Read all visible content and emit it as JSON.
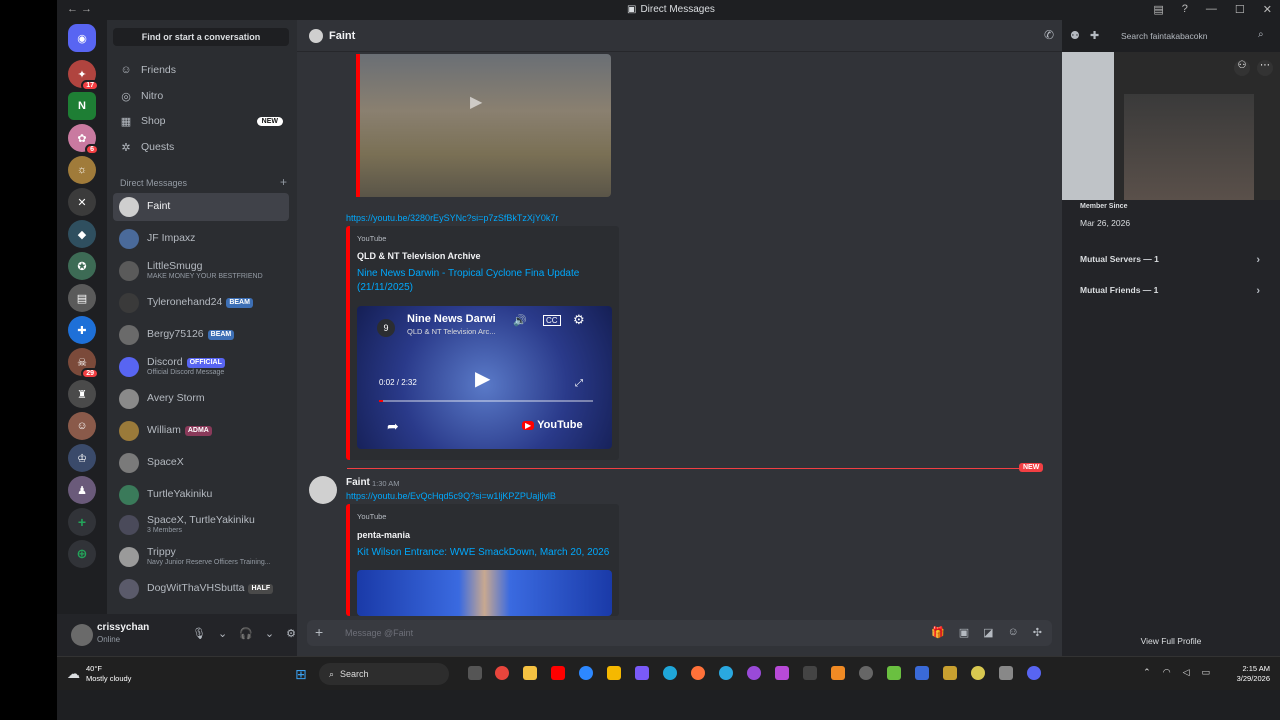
{
  "titlebar": {
    "title": "Direct Messages"
  },
  "rail": {
    "badges": [
      "17",
      "6",
      "29"
    ]
  },
  "sidebar": {
    "find_label": "Find or start a conversation",
    "nav": [
      {
        "label": "Friends",
        "icon": "friends-icon"
      },
      {
        "label": "Nitro",
        "icon": "nitro-icon"
      },
      {
        "label": "Shop",
        "icon": "shop-icon",
        "badge": "NEW"
      },
      {
        "label": "Quests",
        "icon": "quests-icon"
      }
    ],
    "dm_header": "Direct Messages",
    "dms": [
      {
        "name": "Faint",
        "sub": "",
        "tag": ""
      },
      {
        "name": "JF Impaxz",
        "sub": "",
        "tag": ""
      },
      {
        "name": "LittleSmugg",
        "sub": "MAKE MONEY YOUR BESTFRIEND",
        "tag": ""
      },
      {
        "name": "Tyleronehand24",
        "sub": "",
        "tag": "BEAM"
      },
      {
        "name": "Bergy75126",
        "sub": "",
        "tag": "BEAM"
      },
      {
        "name": "Discord",
        "sub": "Official Discord Message",
        "tag": "OFFICIAL"
      },
      {
        "name": "Avery Storm",
        "sub": "",
        "tag": ""
      },
      {
        "name": "William",
        "sub": "",
        "tag": "ADMA"
      },
      {
        "name": "SpaceX",
        "sub": "",
        "tag": ""
      },
      {
        "name": "TurtleYakiniku",
        "sub": "",
        "tag": ""
      },
      {
        "name": "SpaceX, TurtleYakiniku",
        "sub": "3 Members",
        "tag": ""
      },
      {
        "name": "Trippy",
        "sub": "Navy Junior Reserve Officers Training...",
        "tag": ""
      },
      {
        "name": "DogWitThaVHSbutta",
        "sub": "",
        "tag": "HALF"
      }
    ]
  },
  "user": {
    "name": "crissychan",
    "status": "Online"
  },
  "chat": {
    "channel": "Faint",
    "link1": "https://youtu.be/3280rEySYNc?si=p7zSfBkTzXjY0k7r",
    "embed1": {
      "source": "YouTube",
      "author": "QLD & NT Television Archive",
      "title": "Nine News Darwin - Tropical Cyclone Fina Update (21/11/2025)",
      "video_title": "Nine News Darwi",
      "channel": "QLD & NT Television Arc...",
      "time": "0:02 / 2:32",
      "yt": "YouTube"
    },
    "new_label": "NEW",
    "message": {
      "author": "Faint",
      "time": "1:30 AM",
      "link": "https://youtu.be/EvQcHqd5c9Q?si=w1ljKPZPUajljvlB"
    },
    "embed2": {
      "source": "YouTube",
      "author": "penta-mania",
      "title": "Kit Wilson Entrance: WWE SmackDown, March 20, 2026"
    },
    "composer_placeholder": "Message @Faint"
  },
  "profile": {
    "search_placeholder": "Search faintakabacokn",
    "member_since_label": "Member Since",
    "member_since": "Mar 26, 2026",
    "mutual_servers": "Mutual Servers — 1",
    "mutual_friends": "Mutual Friends — 1",
    "view_full": "View Full Profile"
  },
  "taskbar": {
    "temp": "40°F",
    "weather": "Mostly cloudy",
    "search": "Search",
    "time": "2:15 AM",
    "date": "3/29/2026"
  },
  "colors": {
    "accent": "#5865f2",
    "link": "#00a8fc",
    "youtube": "#ff0000",
    "new": "#f23f43"
  }
}
